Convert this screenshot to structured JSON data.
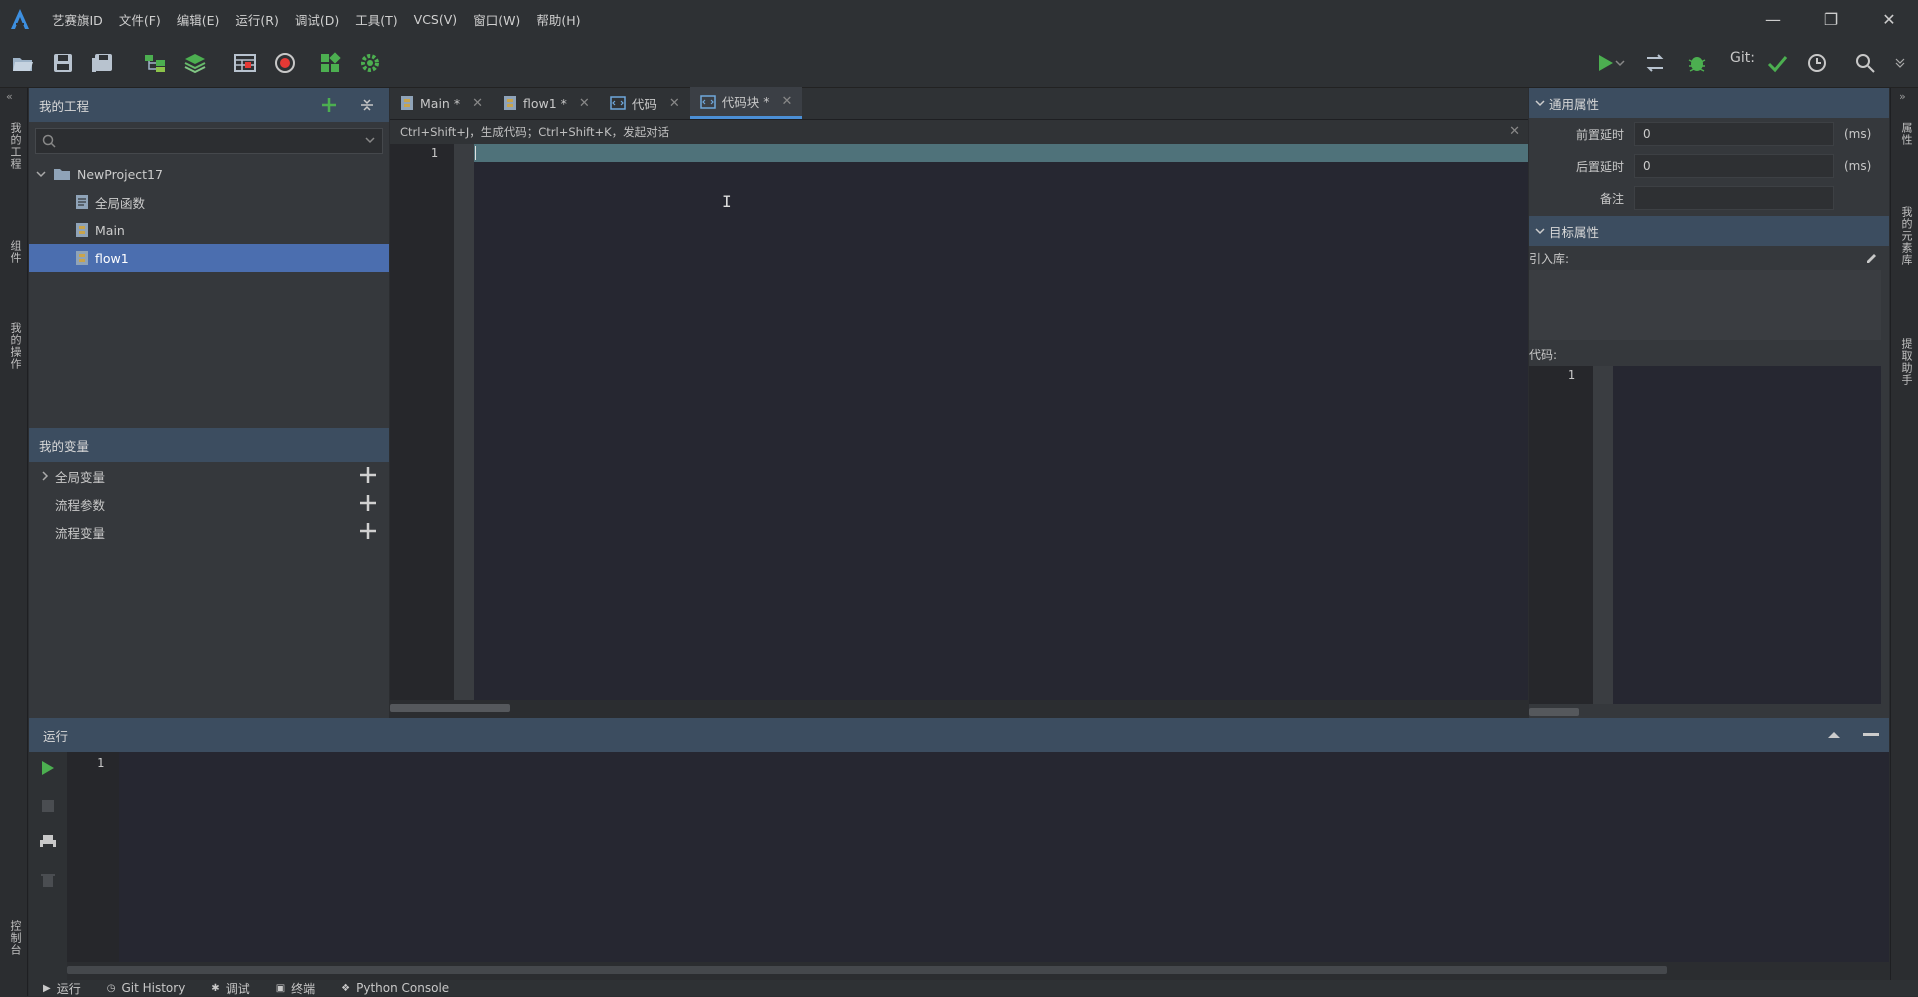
{
  "app": {
    "menu": [
      "艺赛旗ID",
      "文件(F)",
      "编辑(E)",
      "运行(R)",
      "调试(D)",
      "工具(T)",
      "VCS(V)",
      "窗口(W)",
      "帮助(H)"
    ],
    "git_label": "Git:",
    "accent_color": "#4b6eaf",
    "run_color": "#4caf50"
  },
  "left_strip": [
    "我的工程",
    "组件",
    "我的操作",
    "控制台"
  ],
  "right_strip": [
    "属性",
    "我的元素库",
    "提取助手"
  ],
  "project": {
    "title": "我的工程",
    "search_placeholder": "",
    "root": "NewProject17",
    "items": [
      {
        "label": "全局函数",
        "selected": false
      },
      {
        "label": "Main",
        "selected": false
      },
      {
        "label": "flow1",
        "selected": true
      }
    ]
  },
  "variables": {
    "title": "我的变量",
    "items": [
      "全局变量",
      "流程参数",
      "流程变量"
    ]
  },
  "editor": {
    "tabs": [
      {
        "label": "Main",
        "modified": "*",
        "active": false
      },
      {
        "label": "flow1",
        "modified": "*",
        "active": false
      },
      {
        "label": "代码",
        "modified": "",
        "active": false
      },
      {
        "label": "代码块",
        "modified": "*",
        "active": true
      }
    ],
    "hint": "Ctrl+Shift+J，生成代码；Ctrl+Shift+K，发起对话",
    "line_number": "1"
  },
  "properties": {
    "general_title": "通用属性",
    "pre_delay_label": "前置延时",
    "pre_delay_value": "0",
    "post_delay_label": "后置延时",
    "post_delay_value": "0",
    "unit": "(ms)",
    "note_label": "备注",
    "note_value": "",
    "target_title": "目标属性",
    "import_label": "引入库:",
    "code_label": "代码:",
    "code_line": "1"
  },
  "run_panel": {
    "title": "运行",
    "line_number": "1"
  },
  "statusbar": [
    {
      "icon": "play-icon",
      "label": "运行"
    },
    {
      "icon": "clock-icon",
      "label": "Git History"
    },
    {
      "icon": "bug-icon",
      "label": "调试"
    },
    {
      "icon": "terminal-icon",
      "label": "终端"
    },
    {
      "icon": "python-icon",
      "label": "Python Console"
    }
  ]
}
